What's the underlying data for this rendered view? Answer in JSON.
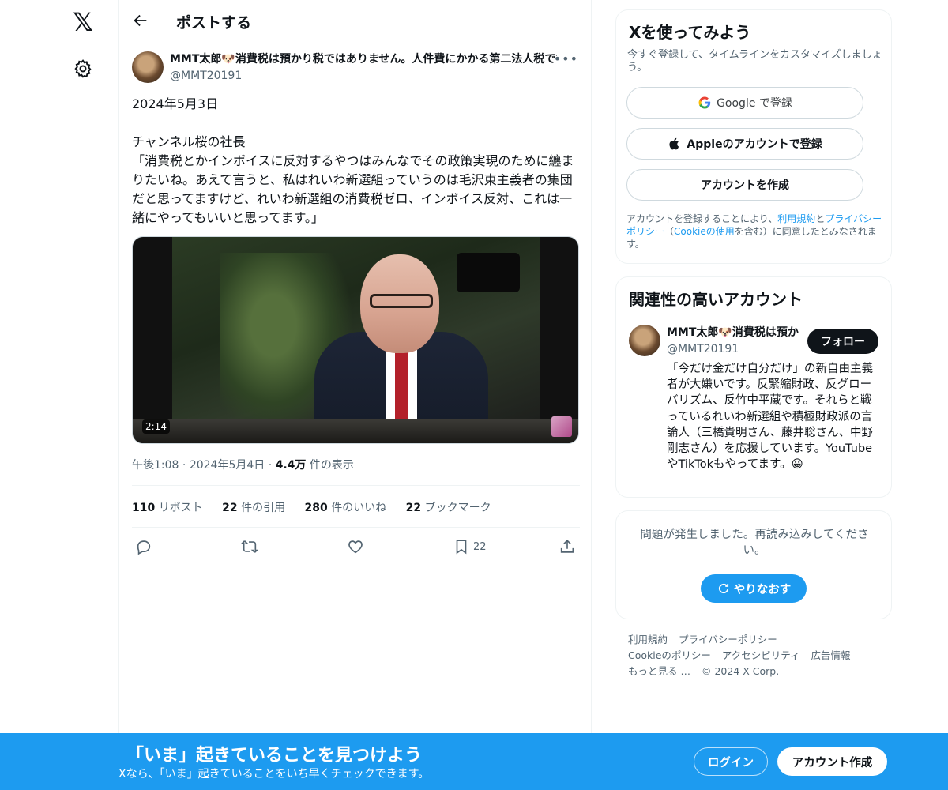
{
  "nav": {
    "logo": "𝕏"
  },
  "header": {
    "title": "ポストする"
  },
  "tweet": {
    "author_name": "MMT太郎🐶消費税は預かり税ではありません。人件費にかかる第二法人税です",
    "author_handle": "@MMT20191",
    "text": "2024年5月3日\n\nチャンネル桜の社長\n「消費税とかインボイスに反対するやつはみんなでその政策実現のために纏まりたいね。あえて言うと、私はれいわ新選組っていうのは毛沢東主義者の集団だと思ってますけど、れいわ新選組の消費税ゼロ、インボイス反対、これは一緒にやってもいいと思ってます。」",
    "video_duration": "2:14",
    "time": "午後1:08",
    "date": "2024年5月4日",
    "views_count": "4.4万",
    "views_label": "件の表示",
    "separator": "·",
    "stats": {
      "reposts": "110",
      "reposts_label": "リポスト",
      "quotes": "22",
      "quotes_label": "件の引用",
      "likes": "280",
      "likes_label": "件のいいね",
      "bookmarks": "22",
      "bookmarks_label": "ブックマーク"
    },
    "bookmark_count": "22"
  },
  "signup": {
    "title": "Xを使ってみよう",
    "subtitle": "今すぐ登録して、タイムラインをカスタマイズしましょう。",
    "google_label": "Google で登録",
    "apple_label": "Appleのアカウントで登録",
    "create_label": "アカウントを作成",
    "legal_prefix": "アカウントを登録することにより、",
    "legal_terms": "利用規約",
    "legal_and": "と",
    "legal_privacy": "プライバシーポリシー",
    "legal_mid": "（",
    "legal_cookie": "Cookieの使用",
    "legal_suffix": "を含む）に同意したとみなされます。"
  },
  "relevant": {
    "title": "関連性の高いアカウント",
    "name": "MMT太郎🐶消費税は預かり税ではありません",
    "handle": "@MMT20191",
    "follow_label": "フォロー",
    "bio": "「今だけ金だけ自分だけ」の新自由主義者が大嫌いです。反緊縮財政、反グローバリズム、反竹中平蔵です。それらと戦っているれいわ新選組や積極財政派の言論人（三橋貴明さん、藤井聡さん、中野剛志さん）を応援しています。YouTubeやTikTokもやってます。😀"
  },
  "error": {
    "message": "問題が発生しました。再読み込みしてください。",
    "retry_label": "やりなおす"
  },
  "footer": {
    "links": [
      "利用規約",
      "プライバシーポリシー",
      "Cookieのポリシー",
      "アクセシビリティ",
      "広告情報",
      "もっと見る …",
      "© 2024 X Corp."
    ]
  },
  "banner": {
    "title": "「いま」起きていることを見つけよう",
    "subtitle": "Xなら、「いま」起きていることをいち早くチェックできます。",
    "login_label": "ログイン",
    "create_label": "アカウント作成"
  },
  "colors": {
    "accent": "#1d9bf0",
    "text": "#0f1419",
    "muted": "#536471"
  }
}
